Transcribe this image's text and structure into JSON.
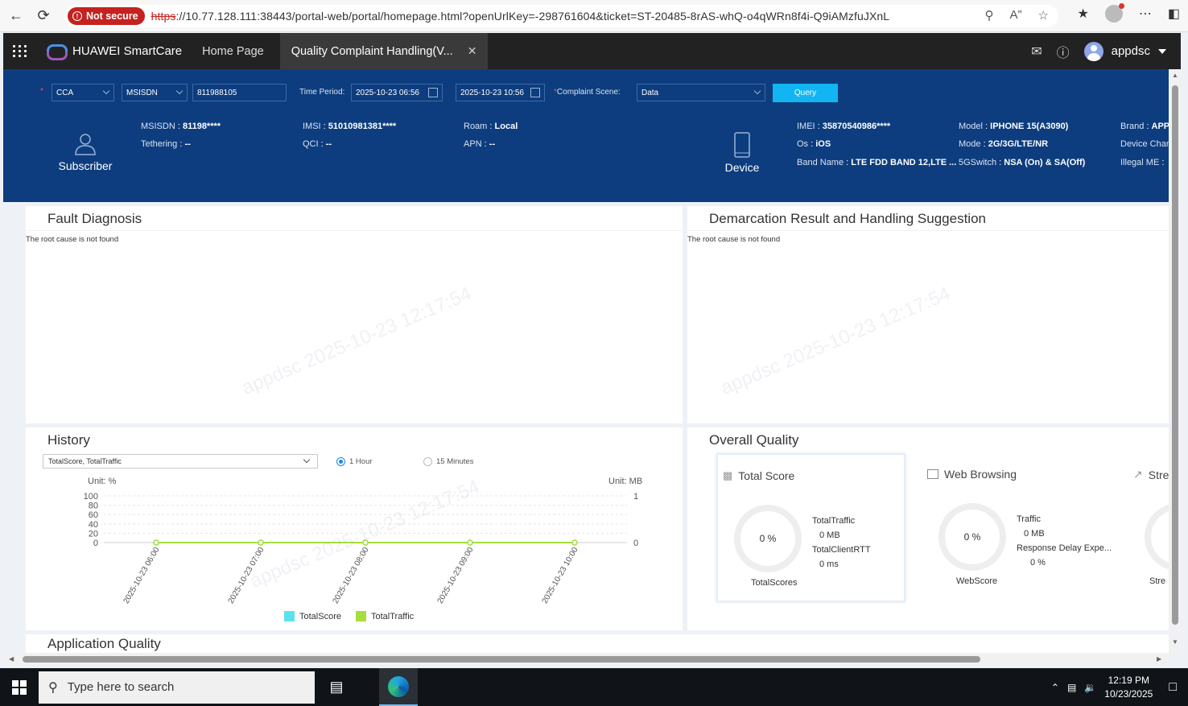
{
  "browser": {
    "not_secure": "Not secure",
    "url_scheme": "https",
    "url_rest": "://10.77.128.111:38443/portal-web/portal/homepage.html?openUrlKey=-298761604&ticket=ST-20485-8rAS-whQ-o4qWRn8f4i-Q9iAMzfuJXnL"
  },
  "app": {
    "brand": "HUAWEI SmartCare",
    "tabs": [
      {
        "label": "Home Page"
      },
      {
        "label": "Quality Complaint Handling(V..."
      }
    ],
    "user": "appdsc"
  },
  "query": {
    "type_value": "CCA",
    "id_type_value": "MSISDN",
    "id_value": "811988105",
    "time_label": "Time Period:",
    "start_time": "2025-10-23 06:56",
    "end_time": "2025-10-23 10:56",
    "scene_label": "Complaint Scene:",
    "scene_value": "Data",
    "query_button": "Query"
  },
  "subscriber": {
    "title": "Subscriber",
    "fields": [
      {
        "k": "MSISDN",
        "v": "81198****"
      },
      {
        "k": "Tethering",
        "v": "--"
      },
      {
        "k": "IMSI",
        "v": "51010981381****"
      },
      {
        "k": "QCI",
        "v": "--"
      },
      {
        "k": "Roam",
        "v": "Local"
      },
      {
        "k": "APN",
        "v": "--"
      }
    ]
  },
  "device": {
    "title": "Device",
    "fields": [
      {
        "k": "IMEI",
        "v": "35870540986****"
      },
      {
        "k": "Os",
        "v": "iOS"
      },
      {
        "k": "Band Name",
        "v": "LTE FDD BAND 12,LTE ..."
      },
      {
        "k": "Model",
        "v": "IPHONE 15(A3090)"
      },
      {
        "k": "Mode",
        "v": "2G/3G/LTE/NR"
      },
      {
        "k": "5GSwitch",
        "v": "NSA (On) & SA(Off)"
      },
      {
        "k": "Brand",
        "v": "APP"
      },
      {
        "k": "Device Char",
        "v": ""
      },
      {
        "k": "Illegal ME",
        "v": ""
      }
    ]
  },
  "fault": {
    "title": "Fault Diagnosis",
    "text": "The root cause is not found"
  },
  "demarcation": {
    "title": "Demarcation Result and Handling Suggestion",
    "text": "The root cause is not found"
  },
  "history": {
    "title": "History",
    "select_value": "TotalScore, TotalTraffic",
    "radio_1": "1 Hour",
    "radio_2": "15 Minutes",
    "selected_radio": "1 Hour"
  },
  "chart_data": {
    "type": "line",
    "x": [
      "2025-10-23 06:00",
      "2025-10-23 07:00",
      "2025-10-23 08:00",
      "2025-10-23 09:00",
      "2025-10-23 10:00"
    ],
    "left_unit": "Unit: %",
    "right_unit": "Unit: MB",
    "left_ticks": [
      "100",
      "80",
      "60",
      "40",
      "20",
      "0"
    ],
    "right_ticks": [
      "1",
      "0"
    ],
    "ylim_left": [
      0,
      100
    ],
    "ylim_right": [
      0,
      1
    ],
    "series": [
      {
        "name": "TotalScore",
        "color": "#5ae3ee",
        "values": [
          0,
          0,
          0,
          0,
          0
        ]
      },
      {
        "name": "TotalTraffic",
        "color": "#a6de3e",
        "values": [
          0,
          0,
          0,
          0,
          0
        ]
      }
    ]
  },
  "overall": {
    "title": "Overall Quality",
    "tiles": [
      {
        "title": "Total Score",
        "ring": "0 %",
        "ring_label": "TotalScores",
        "kv": [
          {
            "k": "TotalTraffic",
            "v": "0 MB"
          },
          {
            "k": "TotalClientRTT",
            "v": "0 ms"
          }
        ]
      },
      {
        "title": "Web Browsing",
        "ring": "0 %",
        "ring_label": "WebScore",
        "kv": [
          {
            "k": "Traffic",
            "v": "0 MB"
          },
          {
            "k": "Response Delay Expe...",
            "v": "0 %"
          }
        ]
      },
      {
        "title": "Stre",
        "ring_label": "Stre"
      }
    ]
  },
  "app_quality": {
    "title": "Application Quality"
  },
  "watermark": "appdsc 2025-10-23 12:17:54",
  "taskbar": {
    "search_placeholder": "Type here to search",
    "time": "12:19 PM",
    "date": "10/23/2025"
  }
}
